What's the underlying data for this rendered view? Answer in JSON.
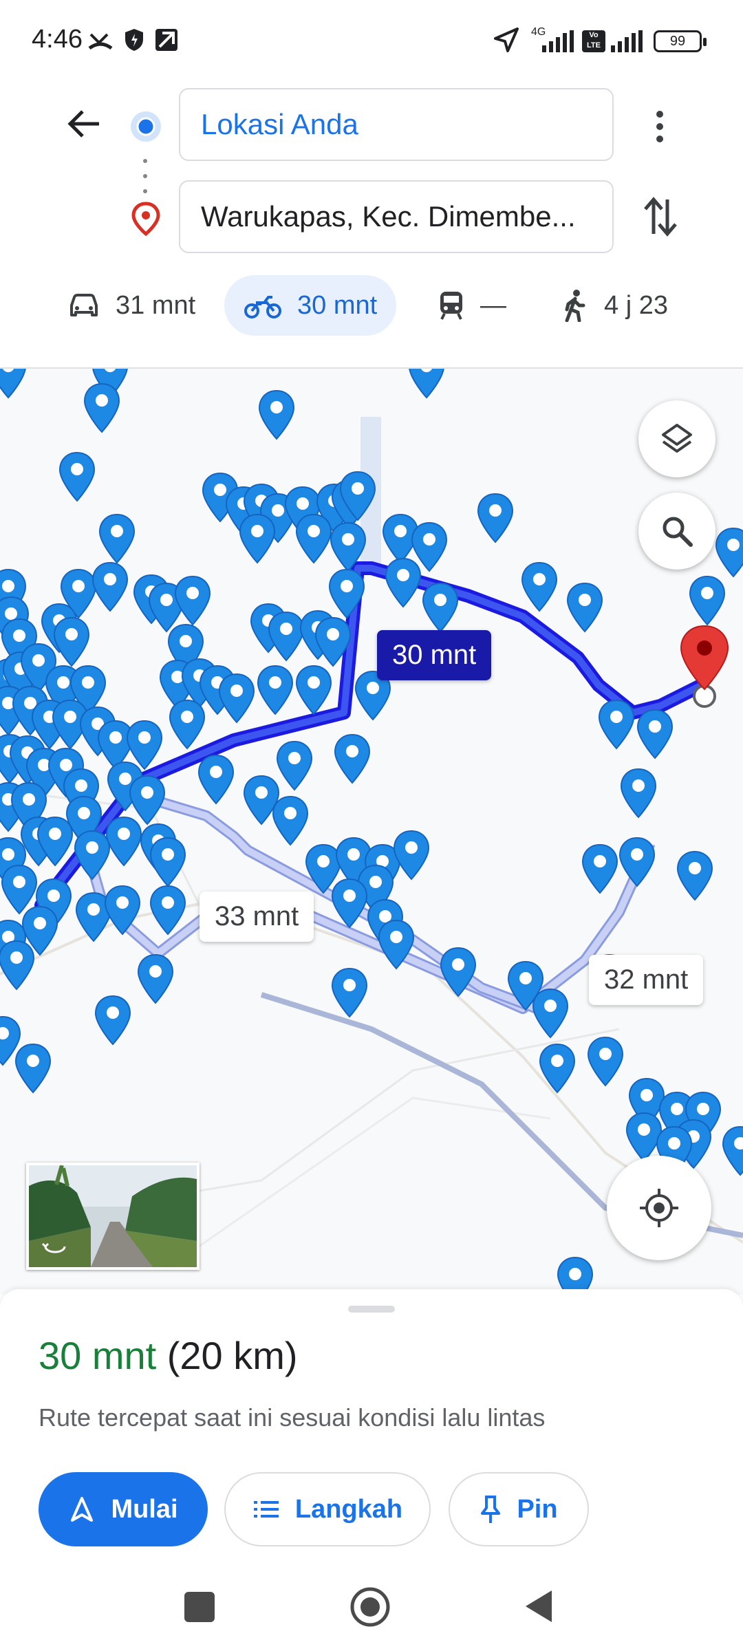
{
  "status_bar": {
    "time": "4:46",
    "network_type": "4G",
    "volte": "Vo LTE",
    "battery": "99"
  },
  "directions": {
    "back_icon": "arrow-left-icon",
    "origin": "Lokasi Anda",
    "destination": "Warukapas, Kec. Dimembe...",
    "more_icon": "more-vert-icon",
    "swap_icon": "swap-vertical-icon"
  },
  "modes": [
    {
      "icon": "car-icon",
      "label": "31 mnt",
      "active": false
    },
    {
      "icon": "motorcycle-icon",
      "label": "30 mnt",
      "active": true
    },
    {
      "icon": "transit-icon",
      "label": "—",
      "active": false
    },
    {
      "icon": "walk-icon",
      "label": "4 j 23",
      "active": false
    }
  ],
  "map": {
    "route_labels": {
      "selected": "30 mnt",
      "alt1": "33 mnt",
      "alt2": "32 mnt"
    },
    "layers_icon": "layers-icon",
    "search_icon": "search-icon",
    "locate_icon": "my-location-icon",
    "colors": {
      "selected_route": "#1a1ae0",
      "alt_route": "#aab4f0",
      "marker": "#1e88e5",
      "destination_pin": "#e53935"
    }
  },
  "sheet": {
    "eta": "30 mnt",
    "distance": "(20 km)",
    "note": "Rute tercepat saat ini sesuai kondisi lalu lintas",
    "buttons": {
      "start": "Mulai",
      "steps": "Langkah",
      "pin": "Pin"
    }
  },
  "nav_bar": {
    "recents_icon": "square-icon",
    "home_icon": "circle-home-icon",
    "back_icon": "triangle-back-icon"
  }
}
